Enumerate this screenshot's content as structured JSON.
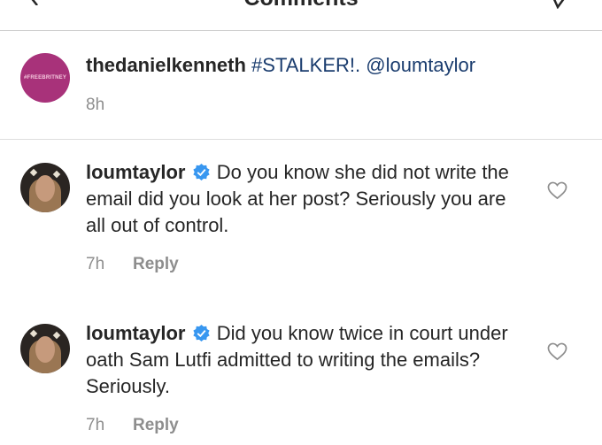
{
  "header": {
    "title": "Comments"
  },
  "caption": {
    "avatar_text": "#FREEBRITNEY",
    "username": "thedanielkenneth",
    "hashtag": "#STALKER!.",
    "mention": "@loumtaylor",
    "time": "8h"
  },
  "comments": [
    {
      "username": "loumtaylor",
      "text": "Do you know she did not write the email did you look at her post? Seriously you are all out of control.",
      "time": "7h",
      "reply_label": "Reply"
    },
    {
      "username": "loumtaylor",
      "text": "Did you know twice in court under oath Sam Lutfi admitted to writing the emails? Seriously.",
      "time": "7h",
      "reply_label": "Reply"
    }
  ],
  "colors": {
    "verified": "#3897f0",
    "link": "#1a3c6e",
    "muted": "#8e8e8e",
    "avatar_bg": "#a8327a"
  },
  "icons": {
    "back": "chevron-left-icon",
    "send": "paper-plane-icon",
    "verified": "verified-badge-icon",
    "like": "heart-outline-icon"
  }
}
